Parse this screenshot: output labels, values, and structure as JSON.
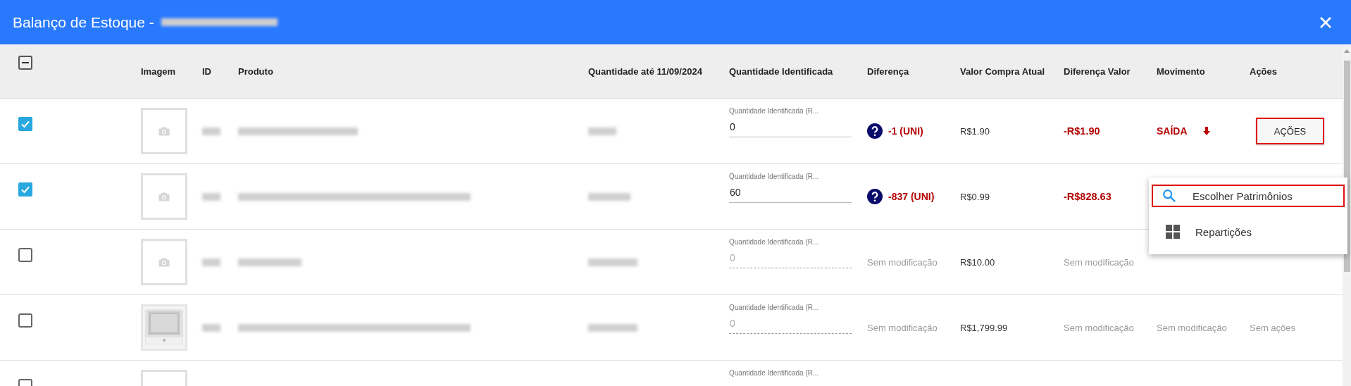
{
  "window": {
    "title": "Balanço de Estoque -"
  },
  "table": {
    "select_all": {
      "indeterminate": true
    },
    "columns": [
      "Imagem",
      "ID",
      "Produto",
      "Quantidade até 11/09/2024",
      "Quantidade Identificada",
      "Diferença",
      "Valor Compra Atual",
      "Diferença Valor",
      "Movimento",
      "Ações"
    ],
    "rows": [
      {
        "checked": true,
        "image": {
          "kind": "placeholder"
        },
        "field": {
          "label": "Quantidade Identificada (R...",
          "value": "0",
          "disabled": false
        },
        "difference": {
          "kind": "change",
          "text": "-1 (UNI)"
        },
        "price": "R$1.90",
        "value_difference": {
          "kind": "change",
          "text": "-R$1.90"
        },
        "movement": {
          "kind": "out",
          "text": "SAÍDA"
        },
        "actions": {
          "kind": "button",
          "text": "AÇÕES",
          "highlighted": true
        }
      },
      {
        "checked": true,
        "image": {
          "kind": "placeholder"
        },
        "field": {
          "label": "Quantidade Identificada (R...",
          "value": "60",
          "disabled": false
        },
        "difference": {
          "kind": "change",
          "text": "-837 (UNI)"
        },
        "price": "R$0.99",
        "value_difference": {
          "kind": "change",
          "text": "-R$828.63"
        }
      },
      {
        "checked": false,
        "image": {
          "kind": "placeholder"
        },
        "field": {
          "label": "Quantidade Identificada (R...",
          "value": "0",
          "disabled": true
        },
        "difference": {
          "kind": "none",
          "text": "Sem modificação"
        },
        "price": "R$10.00",
        "value_difference": {
          "kind": "none",
          "text": "Sem modificação"
        }
      },
      {
        "checked": false,
        "field": {
          "label": "Quantidade Identificada (R...",
          "value": "0",
          "disabled": true
        },
        "difference": {
          "kind": "none",
          "text": "Sem modificação"
        },
        "price": "R$1,799.99",
        "value_difference": {
          "kind": "none",
          "text": "Sem modificação"
        },
        "movement": {
          "kind": "none",
          "text": "Sem modificação"
        },
        "actions": {
          "kind": "none",
          "text": "Sem ações"
        }
      },
      {
        "checked": false,
        "image": {
          "kind": "placeholder"
        },
        "field": {
          "label": "Quantidade Identificada (R..."
        }
      }
    ]
  },
  "menu": {
    "items": [
      {
        "kind": "search",
        "label": "Escolher Patrimônios",
        "highlighted": true
      },
      {
        "kind": "grid",
        "label": "Repartições",
        "highlighted": false
      }
    ]
  }
}
